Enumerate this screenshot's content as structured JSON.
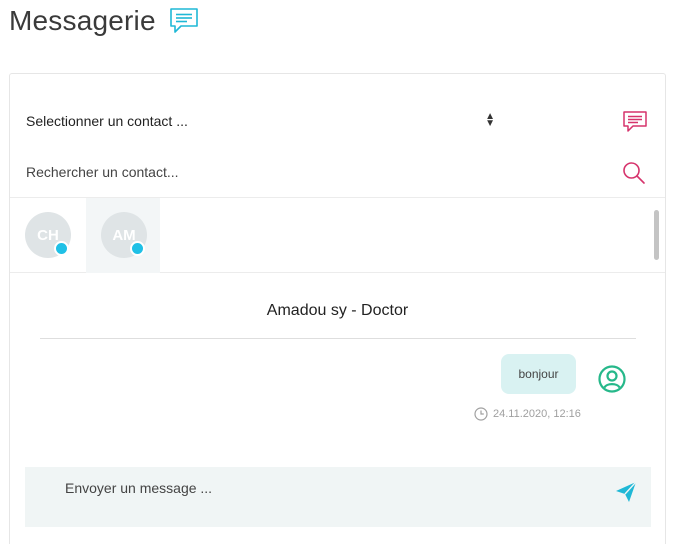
{
  "page": {
    "title": "Messagerie"
  },
  "selector": {
    "contact_placeholder": "Selectionner un contact ..."
  },
  "search": {
    "placeholder": "Rechercher un contact..."
  },
  "contacts": [
    {
      "initials": "CH",
      "active": false,
      "online": true
    },
    {
      "initials": "AM",
      "active": true,
      "online": true
    }
  ],
  "conversation": {
    "name": "Amadou sy - Doctor",
    "messages": [
      {
        "text": "bonjour",
        "time": "24.11.2020, 12:16"
      }
    ]
  },
  "composer": {
    "placeholder": "Envoyer un message ..."
  },
  "icons": {
    "title": "chat-bubble-icon",
    "new_message": "new-message-icon",
    "search": "search-icon",
    "user": "user-circle-icon",
    "clock": "clock-icon",
    "send": "send-icon"
  },
  "colors": {
    "teal": "#1fb8d6",
    "pink": "#d6336c",
    "green": "#26b88a",
    "bubble": "#d9f2f2",
    "online": "#1fc0e6"
  }
}
